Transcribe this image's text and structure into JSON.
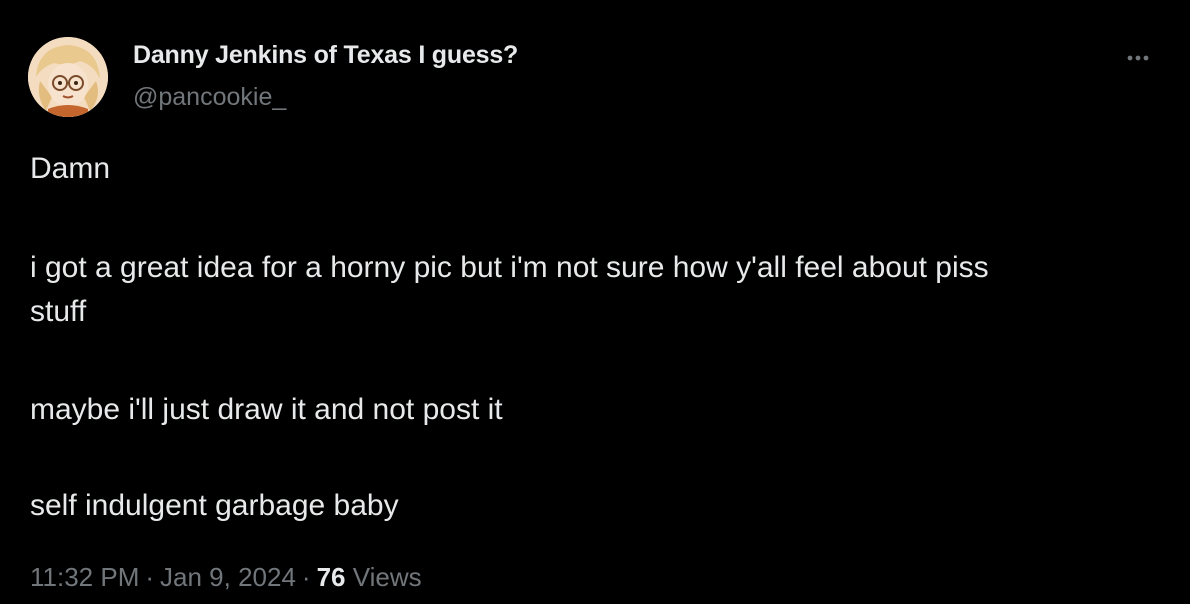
{
  "author": {
    "display_name": "Danny Jenkins of Texas I guess?",
    "handle": "@pancookie_",
    "avatar_icon": "cartoon-avatar-icon"
  },
  "post": {
    "line1": "Damn",
    "line2a": "i got a great idea for a horny pic but i'm not sure how y'all feel about piss",
    "line2b": "stuff",
    "line3": "maybe i'll just draw it and not post it",
    "line4": "self indulgent garbage baby"
  },
  "meta": {
    "time": "11:32 PM",
    "separator": "·",
    "date": "Jan 9, 2024",
    "views_count": "76",
    "views_label": "Views"
  },
  "icons": {
    "more": "more-options-icon"
  },
  "colors": {
    "background": "#000000",
    "primary_text": "#e7e9ea",
    "secondary_text": "#71767b"
  }
}
